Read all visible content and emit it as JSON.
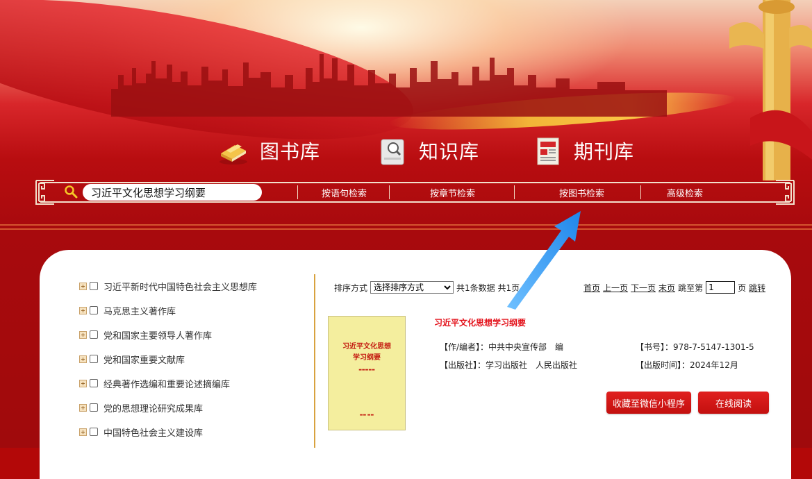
{
  "categories": [
    {
      "label": "图书库",
      "icon": "book-icon"
    },
    {
      "label": "知识库",
      "icon": "knowledge-search-icon"
    },
    {
      "label": "期刊库",
      "icon": "journal-icon"
    }
  ],
  "search": {
    "value": "习近平文化思想学习纲要",
    "modes": [
      "按语句检索",
      "按章节检索",
      "按图书检索",
      "高级检索"
    ]
  },
  "tree": [
    "习近平新时代中国特色社会主义思想库",
    "马克思主义著作库",
    "党和国家主要领导人著作库",
    "党和国家重要文献库",
    "经典著作选编和重要论述摘编库",
    "党的思想理论研究成果库",
    "中国特色社会主义建设库"
  ],
  "results_toolbar": {
    "sort_label": "排序方式",
    "sort_selected": "选择排序方式",
    "count_text": "共1条数据 共1页",
    "pager": {
      "first": "首页",
      "prev": "上一页",
      "next": "下一页",
      "last": "末页",
      "goto_prefix": "跳至第",
      "page_value": "1",
      "goto_suffix": "页",
      "jump": "跳转"
    }
  },
  "book": {
    "title": "习近平文化思想学习纲要",
    "cover_title_line1": "习近平文化思想",
    "cover_title_line2": "学习纲要",
    "author_label": "【作/编者】：",
    "author": "中共中央宣传部　编",
    "isbn_label": "【书号】：",
    "isbn": "978-7-5147-1301-5",
    "publisher_label": "【出版社】：",
    "publisher": "学习出版社　人民出版社",
    "date_label": "【出版时间】：",
    "date": "2024年12月",
    "btn_collect": "收藏至微信小程序",
    "btn_read": "在线阅读"
  },
  "colors": {
    "banner_red": "#b30808",
    "accent_gold": "#d8a23e",
    "title_red": "#e3111a",
    "arrow_blue": "#2a8ff0"
  }
}
